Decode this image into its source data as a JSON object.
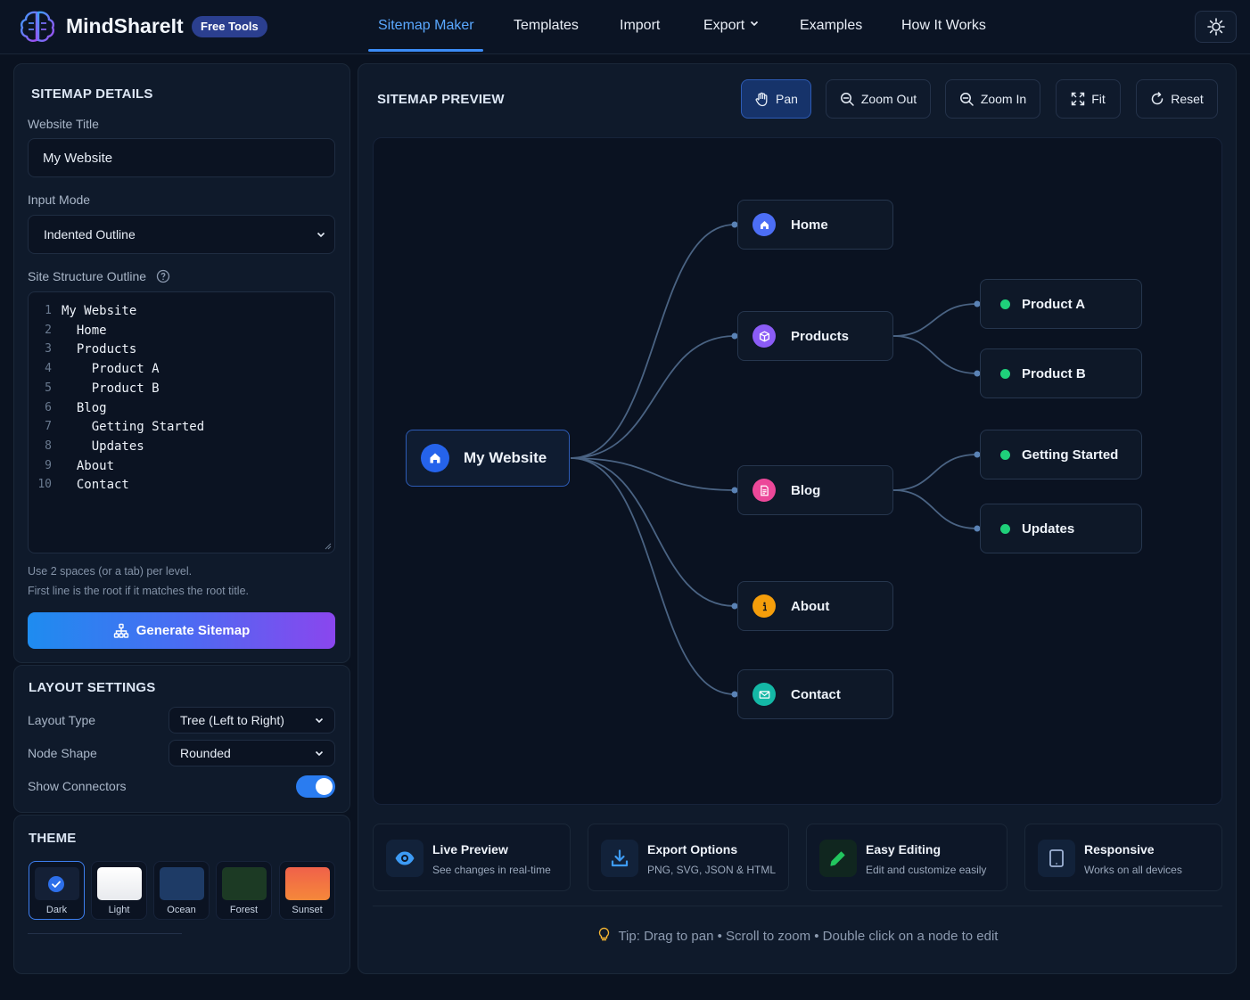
{
  "header": {
    "brand": "MindShareIt",
    "badge": "Free Tools",
    "nav": [
      "Sitemap Maker",
      "Templates",
      "Import",
      "Export",
      "Examples",
      "How It Works"
    ]
  },
  "details": {
    "title": "SITEMAP DETAILS",
    "website_title_label": "Website Title",
    "website_title_value": "My Website",
    "input_mode_label": "Input Mode",
    "input_mode_value": "Indented Outline",
    "outline_label": "Site Structure Outline",
    "outline_lines": [
      {
        "num": "1",
        "text": "My Website"
      },
      {
        "num": "2",
        "text": "  Home"
      },
      {
        "num": "3",
        "text": "  Products"
      },
      {
        "num": "4",
        "text": "    Product A"
      },
      {
        "num": "5",
        "text": "    Product B"
      },
      {
        "num": "6",
        "text": "  Blog"
      },
      {
        "num": "7",
        "text": "    Getting Started"
      },
      {
        "num": "8",
        "text": "    Updates"
      },
      {
        "num": "9",
        "text": "  About"
      },
      {
        "num": "10",
        "text": "  Contact"
      }
    ],
    "help_1": "Use 2 spaces (or a tab) per level.",
    "help_2": "First line is the root if it matches the root title.",
    "generate_label": "Generate Sitemap"
  },
  "layout": {
    "title": "LAYOUT SETTINGS",
    "layout_type_label": "Layout Type",
    "layout_type_value": "Tree (Left to Right)",
    "node_shape_label": "Node Shape",
    "node_shape_value": "Rounded",
    "show_connectors_label": "Show Connectors",
    "show_connectors": true
  },
  "theme": {
    "title": "THEME",
    "options": [
      {
        "label": "Dark",
        "color": "#142036",
        "selected": true
      },
      {
        "label": "Light",
        "color": "#f4f5f7",
        "selected": false
      },
      {
        "label": "Ocean",
        "color": "#1e3b66",
        "selected": false
      },
      {
        "label": "Forest",
        "color": "#1c3a24",
        "selected": false
      },
      {
        "label": "Sunset",
        "color": "#f0614a",
        "selected": false
      }
    ]
  },
  "preview": {
    "title": "SITEMAP PREVIEW",
    "tools": [
      "Pan",
      "Zoom Out",
      "Zoom In",
      "Fit",
      "Reset"
    ],
    "root": "My Website",
    "children": [
      {
        "label": "Home",
        "icon": "home-icon",
        "color": "#4c6ef5"
      },
      {
        "label": "Products",
        "icon": "box-icon",
        "color": "#8b5cf6"
      },
      {
        "label": "Blog",
        "icon": "document-icon",
        "color": "#ec4899"
      },
      {
        "label": "About",
        "icon": "info-icon",
        "color": "#f59e0b"
      },
      {
        "label": "Contact",
        "icon": "mail-icon",
        "color": "#14b8a6"
      }
    ],
    "grandchildren": [
      "Product A",
      "Product B",
      "Getting Started",
      "Updates"
    ]
  },
  "features": [
    {
      "title": "Live Preview",
      "sub": "See changes in real-time",
      "icon": "eye-icon"
    },
    {
      "title": "Export Options",
      "sub": "PNG, SVG, JSON & HTML",
      "icon": "download-icon"
    },
    {
      "title": "Easy Editing",
      "sub": "Edit and customize easily",
      "icon": "pencil-icon"
    },
    {
      "title": "Responsive",
      "sub": "Works on all devices",
      "icon": "tablet-icon"
    }
  ],
  "tip": {
    "prefix": "Tip:",
    "text": "Drag to pan • Scroll to zoom • Double click on a node to edit"
  }
}
